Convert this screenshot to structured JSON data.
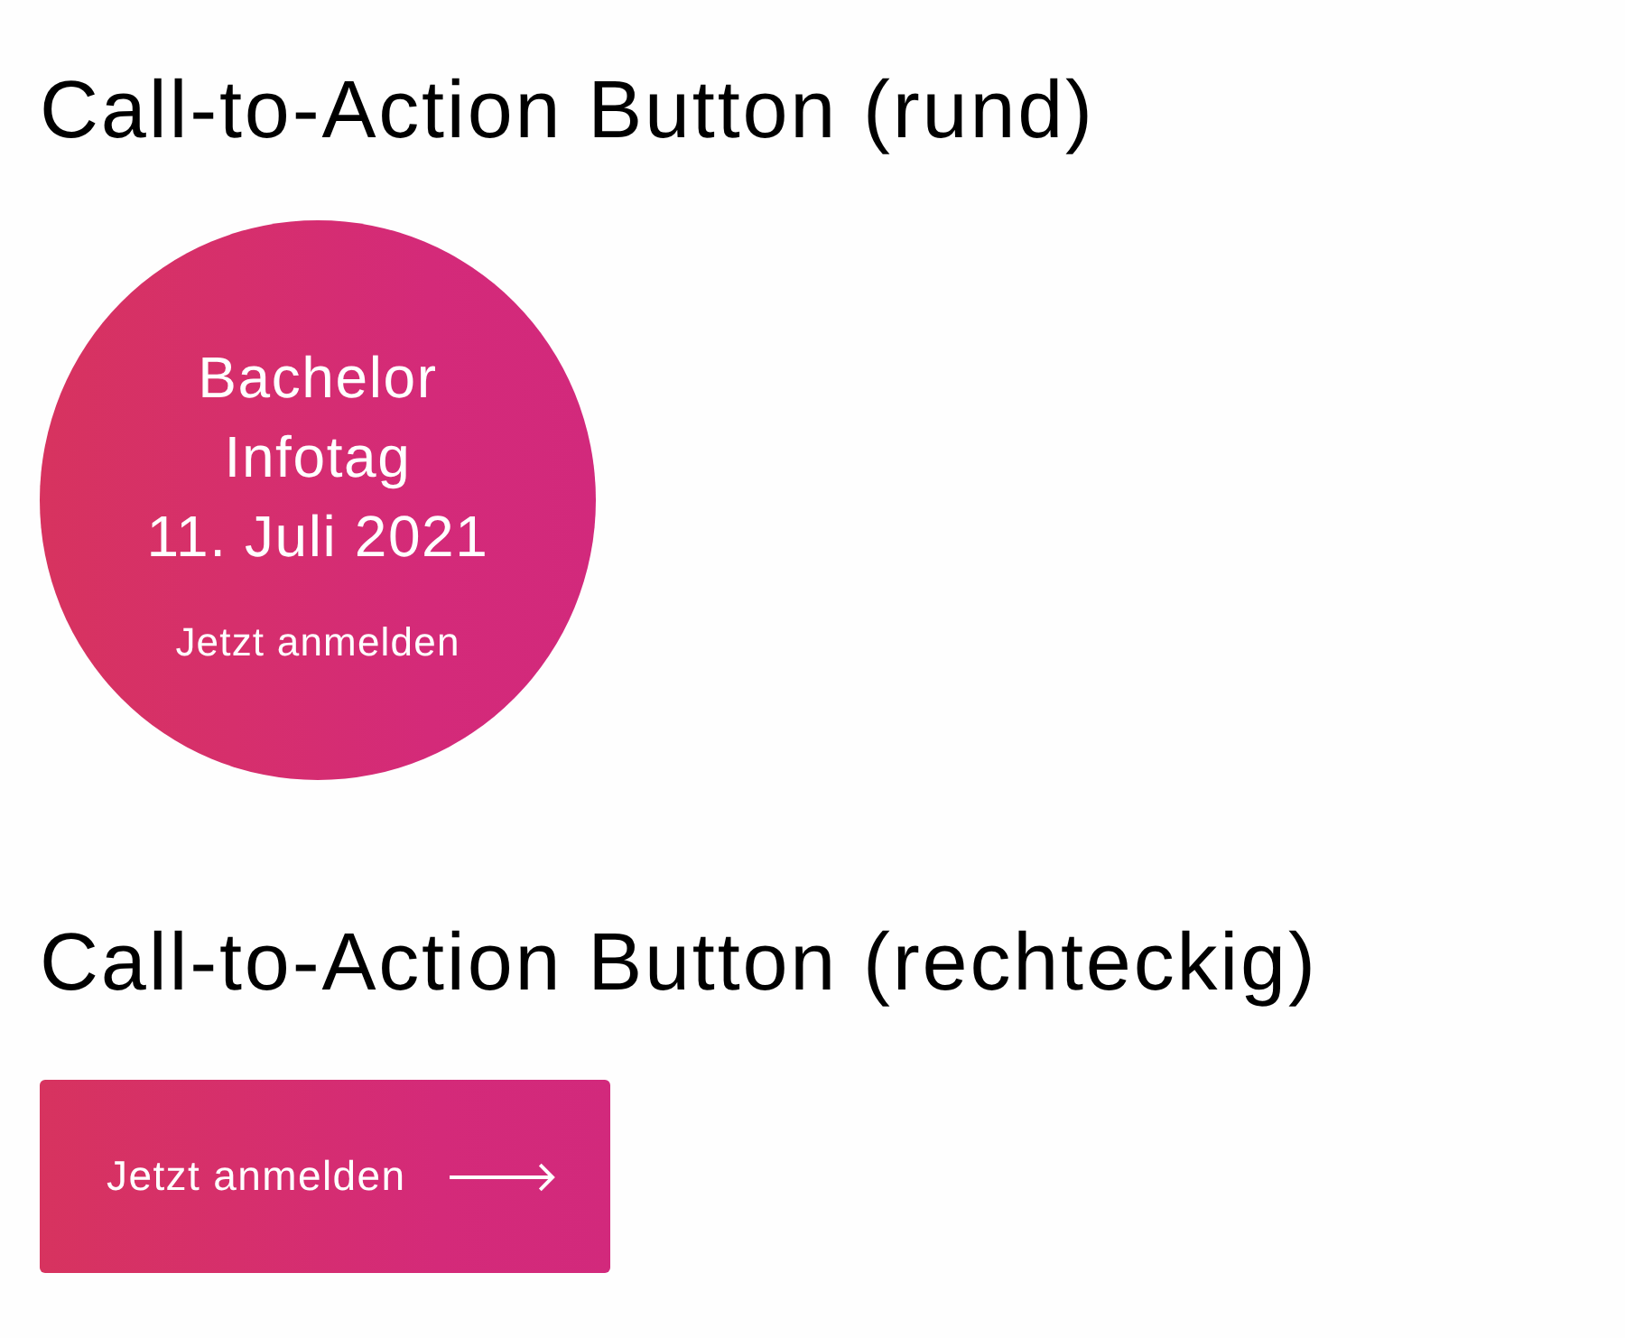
{
  "sections": [
    {
      "kind": "round",
      "heading": "Call-to-Action Button (rund)",
      "button": {
        "title_lines": [
          "Bachelor",
          "Infotag",
          "11. Juli 2021"
        ],
        "action": "Jetzt anmelden"
      }
    },
    {
      "kind": "rectangular",
      "heading": "Call-to-Action Button (rechteckig)",
      "button": {
        "label": "Jetzt anmelden"
      }
    }
  ]
}
